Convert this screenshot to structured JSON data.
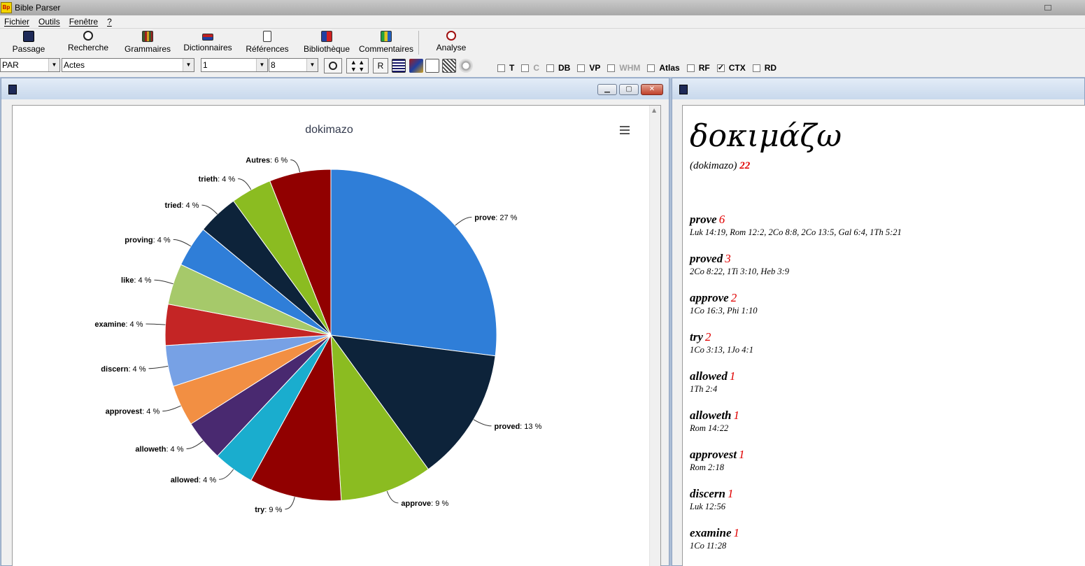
{
  "app": {
    "icon_text": "Bp",
    "title": "Bible Parser"
  },
  "menu": [
    "Fichier",
    "Outils",
    "Fenêtre",
    "?"
  ],
  "toolbar": {
    "buttons": [
      {
        "label": "Passage",
        "icon": "passage-book-icon"
      },
      {
        "label": "Recherche",
        "icon": "search-magnifier-icon"
      },
      {
        "label": "Grammaires",
        "icon": "grammar-books-icon"
      },
      {
        "label": "Dictionnaires",
        "icon": "dictionary-icon"
      },
      {
        "label": "Références",
        "icon": "references-icon"
      },
      {
        "label": "Bibliothèque",
        "icon": "library-icon"
      },
      {
        "label": "Commentaires",
        "icon": "commentary-icon"
      },
      {
        "label": "Analyse",
        "icon": "analysis-icon"
      }
    ]
  },
  "selectors": {
    "version": "PAR",
    "book": "Actes",
    "chapter": "1",
    "verse": "8",
    "r_button": "R"
  },
  "checkboxes": [
    {
      "label": "T",
      "checked": false,
      "disabled": false
    },
    {
      "label": "C",
      "checked": false,
      "disabled": true
    },
    {
      "label": "DB",
      "checked": false,
      "disabled": false
    },
    {
      "label": "VP",
      "checked": false,
      "disabled": false
    },
    {
      "label": "WHM",
      "checked": false,
      "disabled": true
    },
    {
      "label": "Atlas",
      "checked": false,
      "disabled": false
    },
    {
      "label": "RF",
      "checked": false,
      "disabled": false
    },
    {
      "label": "CTX",
      "checked": true,
      "disabled": false
    },
    {
      "label": "RD",
      "checked": false,
      "disabled": false
    }
  ],
  "chart_data": {
    "type": "pie",
    "title": "dokimazo",
    "categories": [
      "prove",
      "proved",
      "approve",
      "try",
      "allowed",
      "alloweth",
      "approvest",
      "discern",
      "examine",
      "like",
      "proving",
      "tried",
      "trieth",
      "Autres"
    ],
    "values": [
      27,
      13,
      9,
      9,
      4,
      4,
      4,
      4,
      4,
      4,
      4,
      4,
      4,
      6
    ],
    "label_suffix": " %",
    "colors": [
      "#2f7ed8",
      "#0d233a",
      "#8bbc21",
      "#910000",
      "#1aadce",
      "#492970",
      "#f28f43",
      "#77a1e5",
      "#c42525",
      "#a6c96a",
      "#2f7ed8",
      "#0d233a",
      "#8bbc21",
      "#910000"
    ]
  },
  "detail": {
    "headword": "δοκιμάζω",
    "transliteration": "(dokimazo)",
    "total": "22",
    "entries": [
      {
        "word": "prove",
        "count": "6",
        "refs": "Luk 14:19, Rom 12:2, 2Co 8:8, 2Co 13:5, Gal 6:4, 1Th 5:21"
      },
      {
        "word": "proved",
        "count": "3",
        "refs": "2Co 8:22, 1Ti 3:10, Heb 3:9"
      },
      {
        "word": "approve",
        "count": "2",
        "refs": "1Co 16:3, Phi 1:10"
      },
      {
        "word": "try",
        "count": "2",
        "refs": "1Co 3:13, 1Jo 4:1"
      },
      {
        "word": "allowed",
        "count": "1",
        "refs": "1Th 2:4"
      },
      {
        "word": "alloweth",
        "count": "1",
        "refs": "Rom 14:22"
      },
      {
        "word": "approvest",
        "count": "1",
        "refs": "Rom 2:18"
      },
      {
        "word": "discern",
        "count": "1",
        "refs": "Luk 12:56"
      },
      {
        "word": "examine",
        "count": "1",
        "refs": "1Co 11:28"
      }
    ]
  }
}
